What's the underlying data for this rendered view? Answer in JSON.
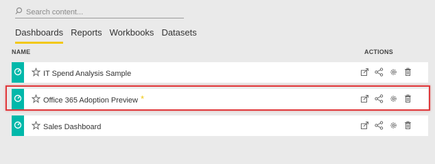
{
  "search": {
    "placeholder": "Search content..."
  },
  "tabs": [
    {
      "label": "Dashboards",
      "active": true
    },
    {
      "label": "Reports",
      "active": false
    },
    {
      "label": "Workbooks",
      "active": false
    },
    {
      "label": "Datasets",
      "active": false
    }
  ],
  "columns": {
    "name": "NAME",
    "actions": "ACTIONS"
  },
  "rows": [
    {
      "name": "IT Spend Analysis Sample",
      "new_marker": ""
    },
    {
      "name": "Office 365 Adoption Preview",
      "new_marker": "*"
    },
    {
      "name": "Sales Dashboard",
      "new_marker": ""
    }
  ],
  "icons": {
    "search": "search-icon",
    "dashboard": "dashboard-gauge-icon",
    "favorite": "star-outline-icon",
    "open": "open-in-icon",
    "share": "share-icon",
    "settings": "gear-icon",
    "delete": "trash-icon"
  },
  "colors": {
    "accent": "#f2c80f",
    "teal": "#01b8aa",
    "highlight": "#e0383b"
  }
}
